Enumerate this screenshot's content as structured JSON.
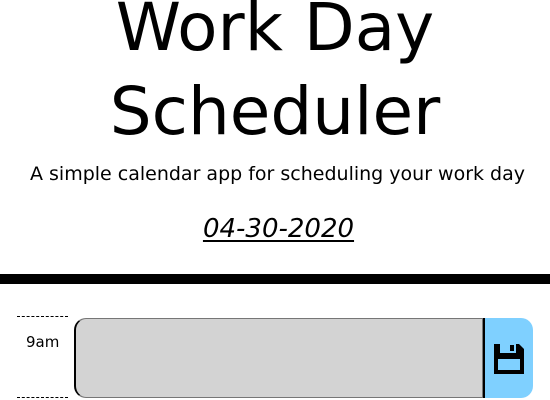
{
  "header": {
    "title": "Work Day Scheduler",
    "lead": "A simple calendar app for scheduling your work day",
    "current_date": "04-30-2020"
  },
  "timeblocks": [
    {
      "hour_label": "9am",
      "task_text": "",
      "save_icon": "floppy-disk-icon"
    }
  ],
  "colors": {
    "task_background": "#d3d3d3",
    "save_button": "#7fd0ff",
    "divider": "#000000"
  }
}
